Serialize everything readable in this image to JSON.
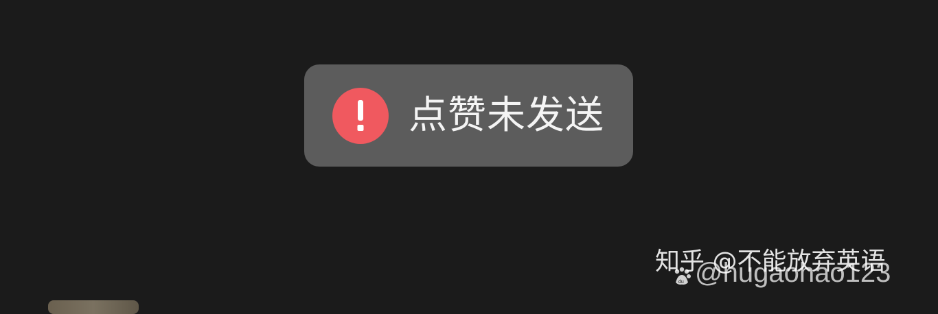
{
  "toast": {
    "message": "点赞未发送",
    "icon": "exclamation-icon",
    "icon_color": "#f0595f",
    "background_color": "#5c5c5c"
  },
  "watermark": {
    "zhihu_text": "知乎 @不能放弃英语",
    "baidu_text": "@hugaohao123",
    "baidu_icon": "baidu-paw-icon"
  },
  "page": {
    "background_color": "#1b1b1b"
  }
}
